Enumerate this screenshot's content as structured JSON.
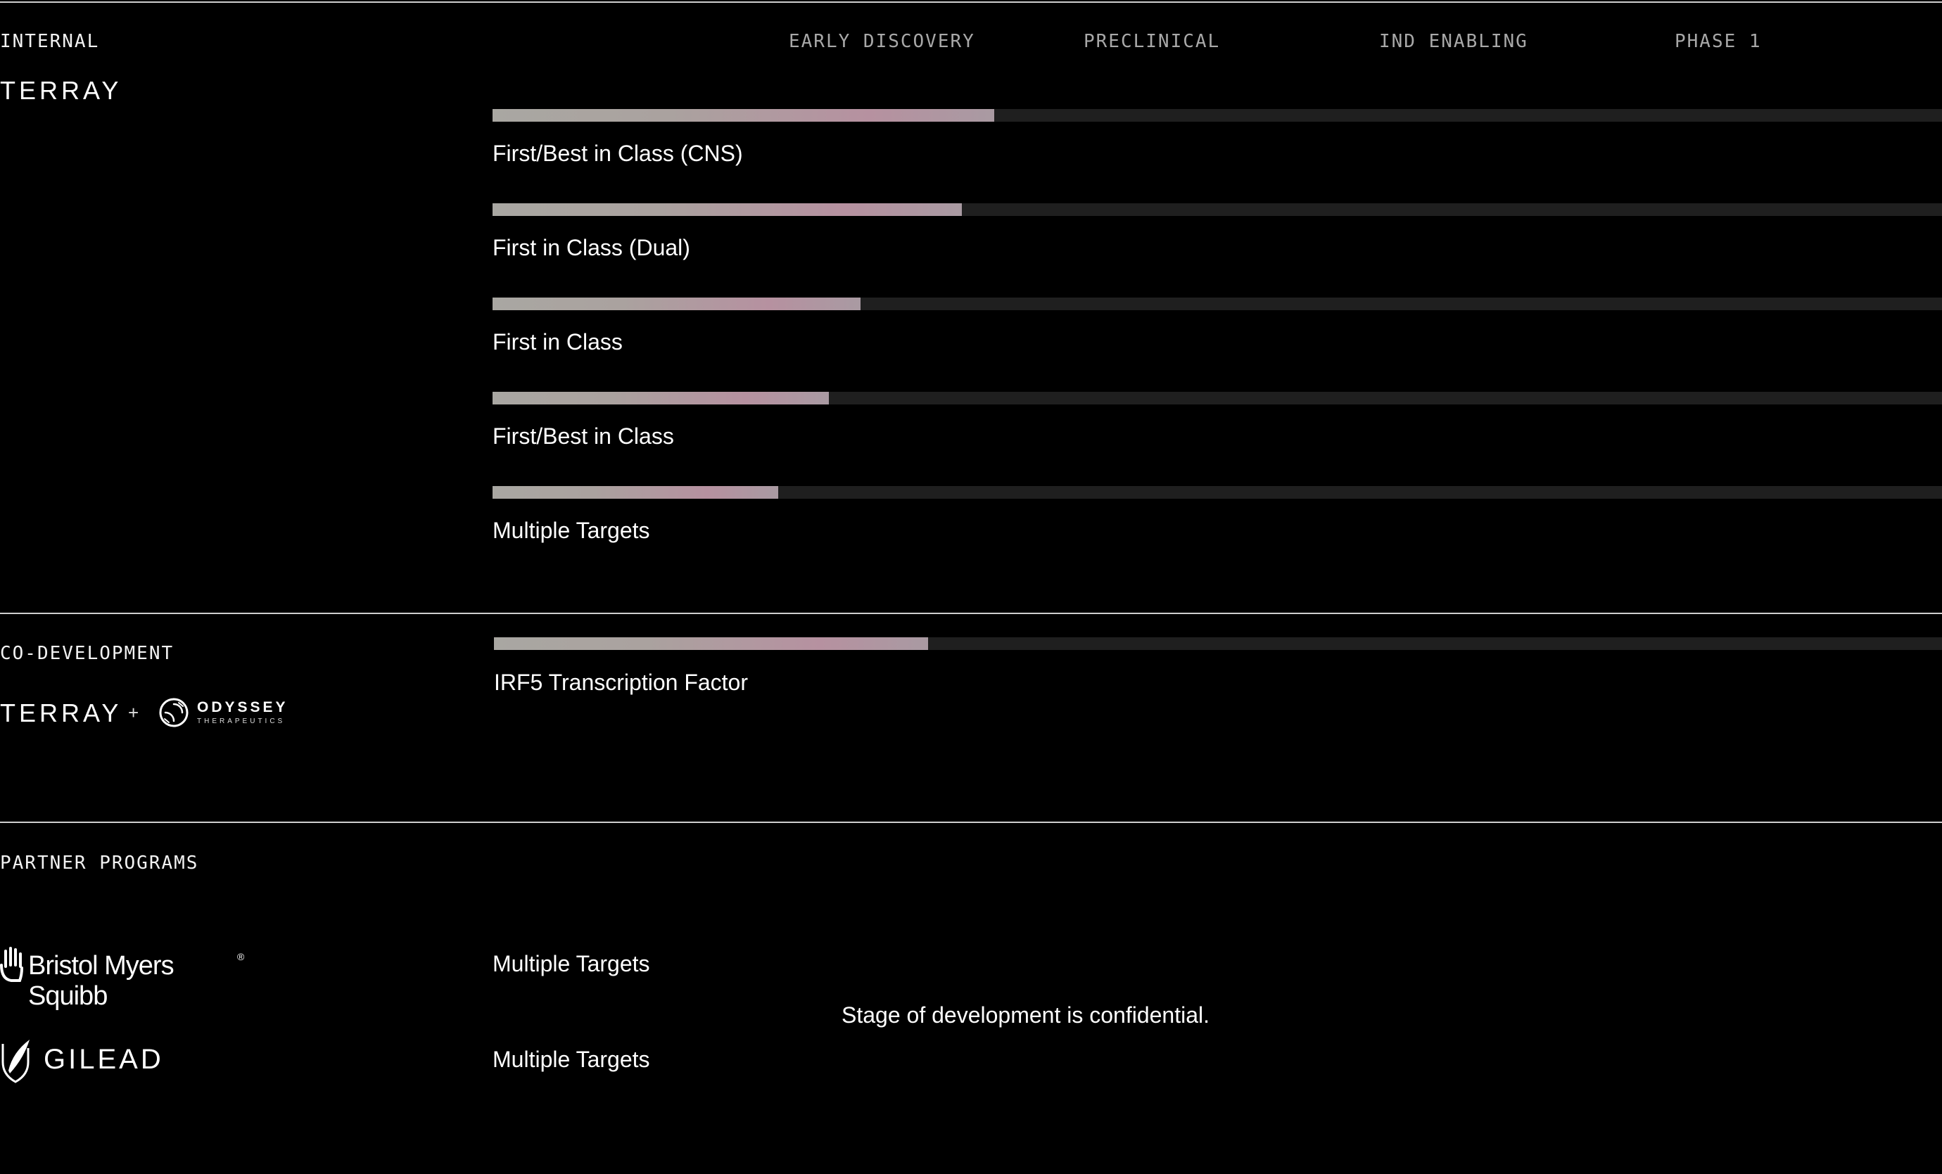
{
  "stages": [
    "EARLY DISCOVERY",
    "PRECLINICAL",
    "IND ENABLING",
    "PHASE 1"
  ],
  "sections": {
    "internal": {
      "label": "INTERNAL",
      "brand": "TERRAY",
      "programs": [
        {
          "label": "First/Best in Class (CNS)",
          "progress": 0.346
        },
        {
          "label": "First in Class (Dual)",
          "progress": 0.324
        },
        {
          "label": "First in Class",
          "progress": 0.254
        },
        {
          "label": "First/Best in Class",
          "progress": 0.232
        },
        {
          "label": "Multiple Targets",
          "progress": 0.197
        }
      ]
    },
    "codevelopment": {
      "label": "CO-DEVELOPMENT",
      "brand": "TERRAY",
      "plus": "+",
      "partner_name": "ODYSSEY",
      "partner_sub": "THERAPEUTICS",
      "programs": [
        {
          "label": "IRF5 Transcription Factor",
          "progress": 0.3
        }
      ]
    },
    "partner": {
      "label": "PARTNER PROGRAMS",
      "partners": [
        {
          "name": "Bristol Myers Squibb",
          "mark": "®",
          "program": "Multiple Targets"
        },
        {
          "name": "GILEAD",
          "program": "Multiple Targets"
        }
      ],
      "note": "Stage of development is confidential."
    }
  },
  "colors": {
    "background": "#000000",
    "track": "#1f1f1f",
    "fill_start": "#a9a7a2",
    "fill_mid": "#b691a0",
    "divider": "#cfcfcf"
  }
}
